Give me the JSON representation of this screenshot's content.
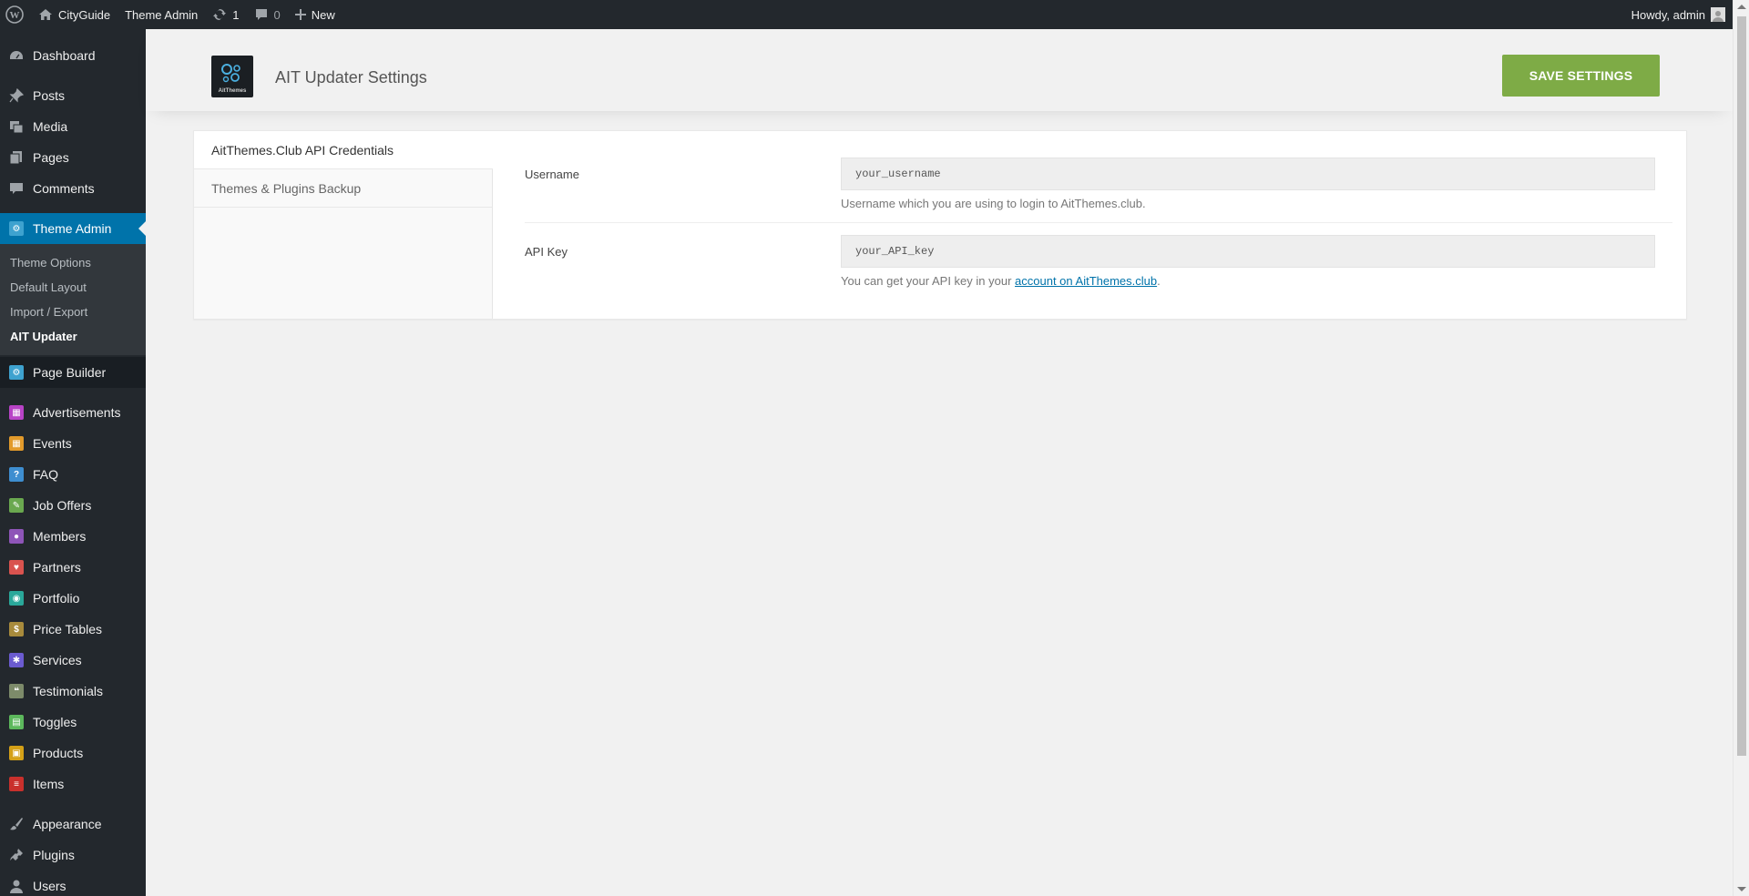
{
  "adminbar": {
    "site_name": "CityGuide",
    "theme_admin": "Theme Admin",
    "updates_count": "1",
    "comments_count": "0",
    "new_label": "New",
    "howdy": "Howdy, admin"
  },
  "sidebar": {
    "dashboard": "Dashboard",
    "posts": "Posts",
    "media": "Media",
    "pages": "Pages",
    "comments": "Comments",
    "theme_admin": "Theme Admin",
    "sub": {
      "theme_options": "Theme Options",
      "default_layout": "Default Layout",
      "import_export": "Import / Export",
      "ait_updater": "AIT Updater"
    },
    "page_builder": "Page Builder",
    "advertisements": "Advertisements",
    "events": "Events",
    "faq": "FAQ",
    "job_offers": "Job Offers",
    "members": "Members",
    "partners": "Partners",
    "portfolio": "Portfolio",
    "price_tables": "Price Tables",
    "services": "Services",
    "testimonials": "Testimonials",
    "toggles": "Toggles",
    "products": "Products",
    "items": "Items",
    "appearance": "Appearance",
    "plugins": "Plugins",
    "users": "Users",
    "icon_colors": {
      "advertisements": "#b843c6",
      "events": "#e29a2b",
      "faq": "#3e8ed0",
      "job_offers": "#6aa84f",
      "members": "#8e55b8",
      "partners": "#d9534f",
      "portfolio": "#2aa89a",
      "price_tables": "#a88b3c",
      "services": "#6b5bd0",
      "testimonials": "#7d8b6a",
      "toggles": "#5cb85c",
      "products": "#d4a017",
      "items": "#c9302c"
    }
  },
  "header": {
    "title": "AIT Updater Settings",
    "save_label": "SAVE SETTINGS",
    "logo_text": "AitThemes"
  },
  "tabs": {
    "credentials": "AitThemes.Club API Credentials",
    "backup": "Themes & Plugins Backup"
  },
  "form": {
    "username_label": "Username",
    "username_value": "your_username",
    "username_help": "Username which you are using to login to AitThemes.club.",
    "apikey_label": "API Key",
    "apikey_value": "your_API_key",
    "apikey_help_prefix": "You can get your API key in your ",
    "apikey_help_link": "account on AitThemes.club",
    "apikey_help_suffix": "."
  }
}
